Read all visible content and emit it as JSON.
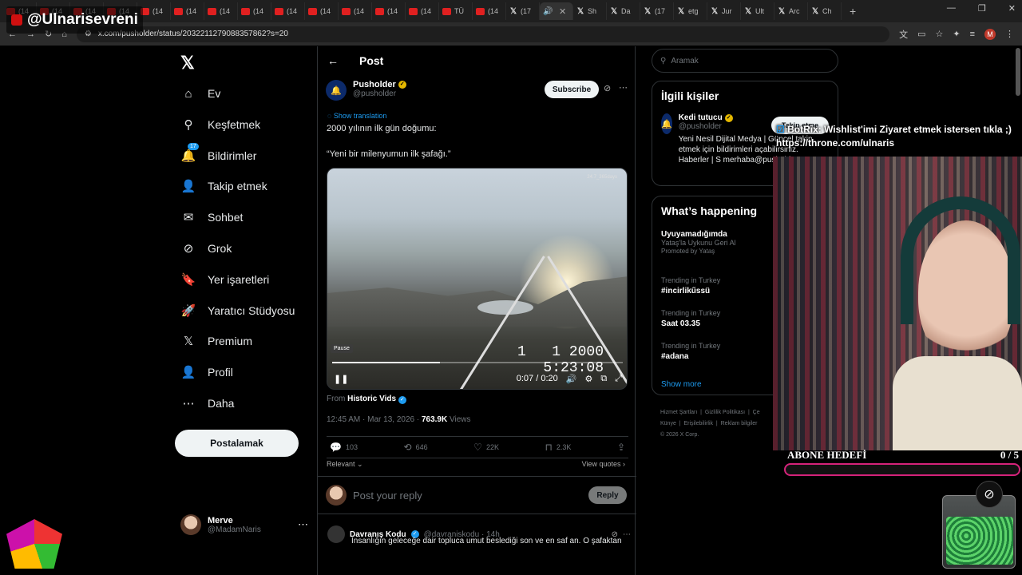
{
  "browser": {
    "tabs": [
      {
        "label": "(14",
        "type": "yt"
      },
      {
        "label": "(14",
        "type": "yt"
      },
      {
        "label": "(14",
        "type": "yt"
      },
      {
        "label": "(14",
        "type": "yt"
      },
      {
        "label": "(14",
        "type": "yt"
      },
      {
        "label": "(14",
        "type": "yt"
      },
      {
        "label": "(14",
        "type": "yt"
      },
      {
        "label": "(14",
        "type": "yt"
      },
      {
        "label": "(14",
        "type": "yt"
      },
      {
        "label": "(14",
        "type": "yt"
      },
      {
        "label": "(14",
        "type": "yt"
      },
      {
        "label": "(14",
        "type": "yt"
      },
      {
        "label": "(14",
        "type": "yt"
      },
      {
        "label": "TÜ",
        "type": "yt"
      },
      {
        "label": "(14",
        "type": "yt"
      },
      {
        "label": "(17",
        "type": "x"
      },
      {
        "label": "",
        "type": "active"
      },
      {
        "label": "Sh",
        "type": "x"
      },
      {
        "label": "Da",
        "type": "x"
      },
      {
        "label": "(17",
        "type": "x"
      },
      {
        "label": "etg",
        "type": "x"
      },
      {
        "label": "Jur",
        "type": "x"
      },
      {
        "label": "Ult",
        "type": "x"
      },
      {
        "label": "Arc",
        "type": "x"
      },
      {
        "label": "Ch",
        "type": "x"
      }
    ],
    "url": "x.com/pusholder/status/2032211279088357862?s=20"
  },
  "overlay": {
    "channel_name": "@Ulnarisevreni"
  },
  "nav": {
    "items": [
      {
        "label": "Ev",
        "icon": "home-icon",
        "glyph": "⌂"
      },
      {
        "label": "Keşfetmek",
        "icon": "search-icon",
        "glyph": "⚲"
      },
      {
        "label": "Bildirimler",
        "icon": "bell-icon",
        "glyph": "🔔"
      },
      {
        "label": "Takip etmek",
        "icon": "add-person-icon",
        "glyph": "👤"
      },
      {
        "label": "Sohbet",
        "icon": "mail-icon",
        "glyph": "✉"
      },
      {
        "label": "Grok",
        "icon": "grok-icon",
        "glyph": "⊘"
      },
      {
        "label": "Yer işaretleri",
        "icon": "bookmark-icon",
        "glyph": "🔖"
      },
      {
        "label": "Yaratıcı Stüdyosu",
        "icon": "rocket-icon",
        "glyph": "🚀"
      },
      {
        "label": "Premium",
        "icon": "x-logo-icon",
        "glyph": "𝕏"
      },
      {
        "label": "Profil",
        "icon": "person-icon",
        "glyph": "👤"
      },
      {
        "label": "Daha",
        "icon": "more-circle-icon",
        "glyph": "⋯"
      }
    ],
    "notif_badge": "17",
    "post_button": "Postalamak",
    "user": {
      "name": "Merve",
      "handle": "@MadamNaris"
    }
  },
  "post": {
    "header_title": "Post",
    "author_name": "Pusholder",
    "author_handle": "@pusholder",
    "subscribe": "Subscribe",
    "show_translation": "Show translation",
    "text_line1": "2000 yılının ilk gün doğumu:",
    "text_line2": "“Yeni bir milenyumun ilk şafağı.”",
    "video": {
      "stamp": "1   1 2000\n5:23:08",
      "tag": "24.7_365days",
      "pause_tip": "Pause",
      "time": "0:07 / 0:20",
      "progress": 0.37
    },
    "from_label": "From",
    "from_name": "Historic Vids",
    "timestamp": "12:45 AM · Mar 13, 2026 · ",
    "views_count": "763.9K",
    "views_label": " Views",
    "stats": {
      "replies": "103",
      "reposts": "646",
      "likes": "22K",
      "bookmarks": "2.3K"
    },
    "sort_label": "Relevant",
    "view_quotes": "View quotes",
    "reply_placeholder": "Post your reply",
    "reply_button": "Reply",
    "reply_post": {
      "name": "Davranış Kodu",
      "handle": "@davraniskodu · 14h",
      "text": "İnsanlığın geleceğe dair topluca umut beslediği son ve en saf an. O şafaktan"
    }
  },
  "right": {
    "search_placeholder": "Aramak",
    "related_title": "İlgili kişiler",
    "related": {
      "name": "Kedi tutucu",
      "handle": "@pusholder",
      "bio": "Yeni Nesil Dijital Medya | Güncel takip etmek için bildirimleri açabilirsiniz. Haberler | S merhaba@pusholder.co",
      "follow": "Takip etme"
    },
    "happening_title": "What’s happening",
    "trends": [
      {
        "meta": "Uyuyamadığımda",
        "title": "Yataş'la Uykunu Geri Al",
        "promo": "Promoted by Yataş"
      },
      {
        "meta": "Trending in Turkey",
        "title": "#incirlikűssü"
      },
      {
        "meta": "Trending in Turkey",
        "title": "Saat 03.35"
      },
      {
        "meta": "Trending in Turkey",
        "title": "#adana"
      }
    ],
    "show_more": "Show more",
    "footer": "Hizmet Şartları  |  Gizlilik Politikası  |  Çe\nKünye  |  Erişilebilirlik  |  Reklam bilgiler\n© 2026 X Corp."
  },
  "stream": {
    "bot_message": "BotRix: Wishlist'imi Ziyaret etmek istersen tıkla ;) https://throne.com/ulnaris",
    "goal_label": "ABONE HEDEFİ",
    "goal_count": "0  / 5"
  }
}
